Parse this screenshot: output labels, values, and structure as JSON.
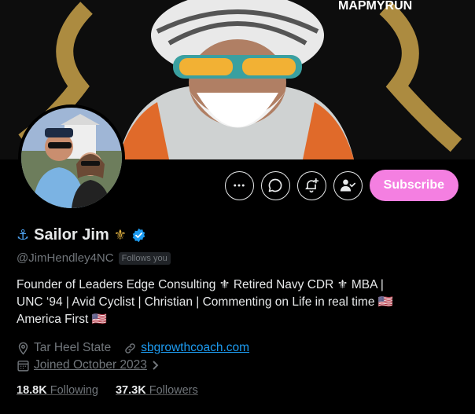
{
  "banner": {
    "watermark": "MAPMYRUN"
  },
  "profile": {
    "display_name": "Sailor Jim",
    "name_prefix_emoji": "⚓",
    "name_suffix_emoji": "⚜",
    "handle": "@JimHendley4NC",
    "follows_you_label": "Follows you",
    "bio_lines": [
      "Founder of Leaders Edge Consulting ⚜ Retired Navy CDR ⚜  MBA |",
      "UNC ‘94 | Avid Cyclist | Christian | Commenting on Life in real time 🇺🇸",
      "America First 🇺🇸"
    ],
    "location": "Tar Heel State",
    "website": "sbgrowthcoach.com",
    "joined": "Joined October 2023"
  },
  "actions": {
    "subscribe_label": "Subscribe"
  },
  "stats": {
    "following_count": "18.8K",
    "following_label": "Following",
    "followers_count": "37.3K",
    "followers_label": "Followers"
  },
  "colors": {
    "subscribe_bg": "#f47fe1",
    "link": "#1d9bf0",
    "verified": "#1d9bf0",
    "muted": "#71767b"
  }
}
